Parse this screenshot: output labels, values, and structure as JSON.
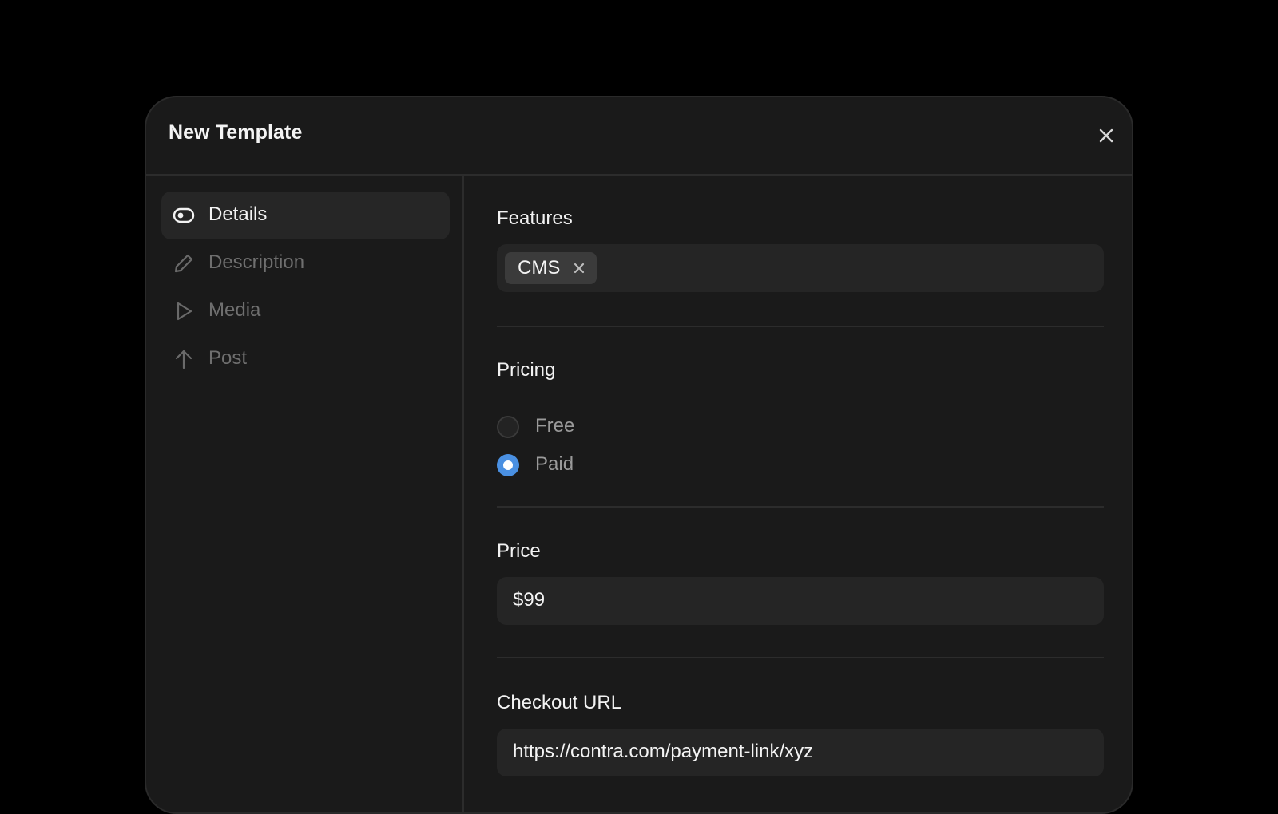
{
  "modal": {
    "title": "New Template"
  },
  "sidebar": {
    "items": [
      {
        "label": "Details",
        "icon": "toggle-icon",
        "active": true
      },
      {
        "label": "Description",
        "icon": "pencil-icon",
        "active": false
      },
      {
        "label": "Media",
        "icon": "play-icon",
        "active": false
      },
      {
        "label": "Post",
        "icon": "arrow-up-icon",
        "active": false
      }
    ]
  },
  "features": {
    "label": "Features",
    "tags": [
      {
        "label": "CMS"
      }
    ]
  },
  "pricing": {
    "label": "Pricing",
    "options": [
      {
        "label": "Free",
        "selected": false
      },
      {
        "label": "Paid",
        "selected": true
      }
    ]
  },
  "price": {
    "label": "Price",
    "value": "$99"
  },
  "checkout": {
    "label": "Checkout URL",
    "value": "https://contra.com/payment-link/xyz"
  },
  "colors": {
    "accent": "#4a90e2",
    "background": "#000000",
    "surface": "#1a1a1a",
    "field": "#252525"
  }
}
